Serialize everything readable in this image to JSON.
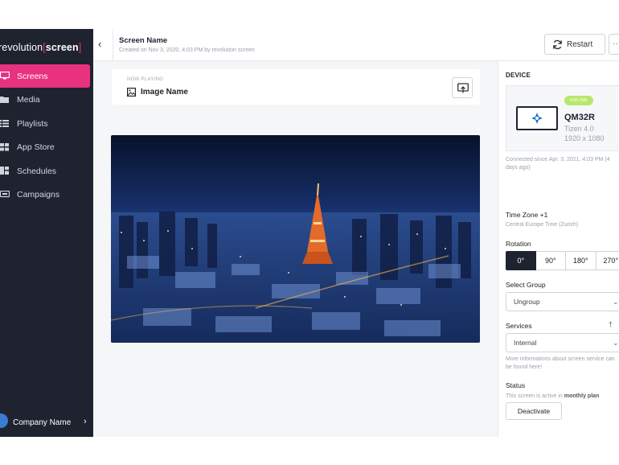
{
  "sidebar": {
    "logo": {
      "left": "revolution",
      "open": "[",
      "brand": "screen",
      "close": "]"
    },
    "items": [
      {
        "label": "Screens",
        "icon": "monitor-icon",
        "active": true
      },
      {
        "label": "Media",
        "icon": "folder-icon",
        "active": false
      },
      {
        "label": "Playlists",
        "icon": "playlist-icon",
        "active": false
      },
      {
        "label": "App Store",
        "icon": "grid-icon",
        "active": false
      },
      {
        "label": "Schedules",
        "icon": "calendar-icon",
        "active": false
      },
      {
        "label": "Campaigns",
        "icon": "campaign-icon",
        "active": false
      }
    ],
    "company": {
      "name": "Company Name",
      "chevron": "›"
    }
  },
  "header": {
    "back": "‹",
    "title": "Screen Name",
    "subtitle": "Created on Nov 3, 2020, 4:03 PM by revolution screen",
    "restart_label": "Restart",
    "more_label": "···"
  },
  "now_playing": {
    "label": "NOW PLAYING",
    "name": "Image Name"
  },
  "device": {
    "section_title": "DEVICE",
    "status_badge": "ONLINE",
    "model": "QM32R",
    "os": "Tizen 4.0",
    "resolution": "1920 x 1080",
    "connected": "Connected since Apr. 3, 2021, 4:03 PM (4 days ago)"
  },
  "timezone": {
    "label": "Time Zone +1",
    "value": "Central Europe Time (Zurich)"
  },
  "rotation": {
    "label": "Rotation",
    "options": [
      "0°",
      "90°",
      "180°",
      "270°"
    ],
    "selected": "0°"
  },
  "group": {
    "label": "Select Group",
    "value": "Ungroup",
    "chevron": "⌄"
  },
  "services": {
    "label": "Services",
    "hint": "†",
    "value": "Internal",
    "chevron": "⌄",
    "info": "More informations about screen service can be found here!"
  },
  "status": {
    "label": "Status",
    "text_prefix": "This screen is active in ",
    "plan": "monthly plan",
    "deactivate_label": "Deactivate"
  },
  "colors": {
    "sidebar": "#1f2330",
    "accent": "#e8317f",
    "online": "#b8e86a"
  }
}
